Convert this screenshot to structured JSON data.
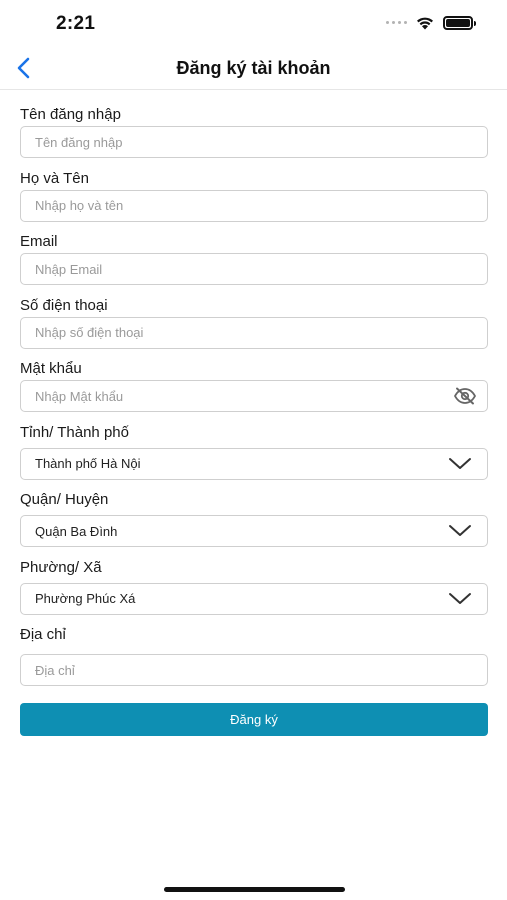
{
  "status_bar": {
    "time": "2:21"
  },
  "nav": {
    "title": "Đăng ký tài khoản",
    "back_icon": "chevron-left-icon"
  },
  "form": {
    "username": {
      "label": "Tên đăng nhập",
      "placeholder": "Tên đăng nhập",
      "value": ""
    },
    "fullname": {
      "label": "Họ và Tên",
      "placeholder": "Nhập họ và tên",
      "value": ""
    },
    "email": {
      "label": "Email",
      "placeholder": "Nhập Email",
      "value": ""
    },
    "phone": {
      "label": "Số điện thoại",
      "placeholder": "Nhập số điện thoại",
      "value": ""
    },
    "password": {
      "label": "Mật khẩu",
      "placeholder": "Nhập Mật khẩu",
      "value": "",
      "toggle_icon": "eye-off-icon"
    },
    "province": {
      "label": "Tỉnh/ Thành phố",
      "value": "Thành phố Hà Nội"
    },
    "district": {
      "label": "Quận/ Huyện",
      "value": "Quận Ba Đình"
    },
    "ward": {
      "label": "Phường/ Xã",
      "value": "Phường Phúc Xá"
    },
    "address": {
      "label": "Địa chỉ",
      "placeholder": "Địa chỉ",
      "value": ""
    }
  },
  "submit": {
    "label": "Đăng ký",
    "color": "#0e8fb3"
  },
  "colors": {
    "accent": "#1a73e8",
    "button": "#0e8fb3",
    "border": "#cfcfcf"
  }
}
